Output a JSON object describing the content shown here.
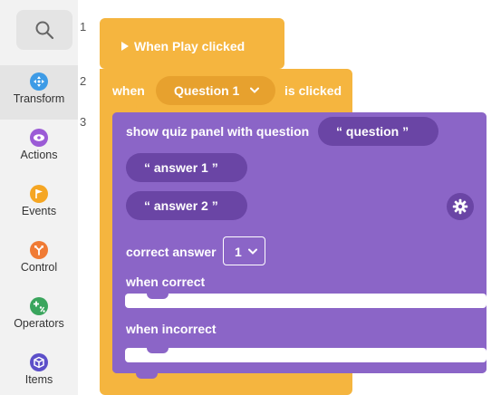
{
  "sidebar": {
    "search_icon": "search-icon",
    "categories": [
      {
        "label": "Transform",
        "icon": "transform-icon",
        "color": "#3e9be6",
        "active": true
      },
      {
        "label": "Actions",
        "icon": "eye-icon",
        "color": "#9b5bd6"
      },
      {
        "label": "Events",
        "icon": "flag-icon",
        "color": "#f5a623"
      },
      {
        "label": "Control",
        "icon": "branch-icon",
        "color": "#f07b34"
      },
      {
        "label": "Operators",
        "icon": "plus-percent-icon",
        "color": "#3aa55d"
      },
      {
        "label": "Items",
        "icon": "cube-icon",
        "color": "#5c4fc9"
      }
    ]
  },
  "line_numbers": [
    "1",
    "2",
    "3"
  ],
  "blocks": {
    "play_block": {
      "label": "When Play clicked"
    },
    "when_block": {
      "prefix": "when",
      "dropdown": {
        "selected": "Question 1"
      },
      "suffix": "is clicked"
    },
    "quiz_block": {
      "title": "show quiz panel with question",
      "question": "“  question  ”",
      "answer1": "“  answer 1  ”",
      "answer2": "“  answer 2  ”",
      "correct_label": "correct answer",
      "correct_value": "1",
      "when_correct": "when correct",
      "when_incorrect": "when incorrect"
    }
  },
  "colors": {
    "orange": "#f5b53f",
    "purple": "#8b65c7",
    "purple_dark": "#6a45a5"
  }
}
